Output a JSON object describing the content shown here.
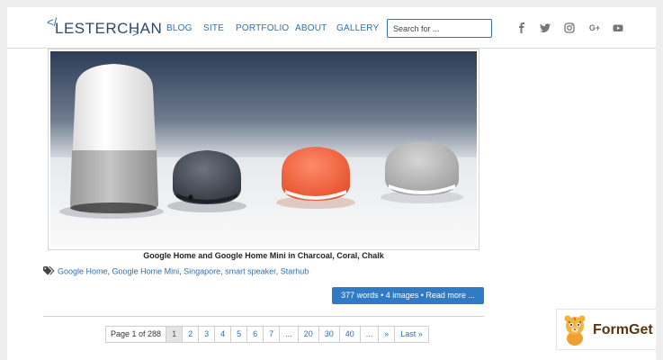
{
  "header": {
    "logo_prefix": "</",
    "logo_text": "LESTERCHAN",
    "logo_suffix": ">",
    "nav": [
      "BLOG",
      "SITE",
      "PORTFOLIO",
      "ABOUT",
      "GALLERY"
    ],
    "search_placeholder": "Search for ...",
    "social_icons": [
      "facebook-icon",
      "twitter-icon",
      "instagram-icon",
      "google-plus-icon",
      "youtube-icon"
    ],
    "social_gplus_label": "G+"
  },
  "post": {
    "caption": "Google Home and Google Home Mini in Charcoal, Coral, Chalk",
    "tags": [
      "Google Home",
      "Google Home Mini",
      "Singapore",
      "smart speaker",
      "Starhub"
    ],
    "read_more": "377 words • 4 images • Read more ..."
  },
  "pagination": {
    "info": "Page 1 of 288",
    "current": "1",
    "pages": [
      "2",
      "3",
      "4",
      "5",
      "6",
      "7"
    ],
    "dots1": "...",
    "jumps": [
      "20",
      "30",
      "40"
    ],
    "dots2": "...",
    "next": "»",
    "last": "Last »"
  },
  "watermark": {
    "text": "FormGet"
  },
  "colors": {
    "link": "#2f6fb1",
    "button": "#2f7bc6",
    "page_bg": "#eeeeee"
  }
}
